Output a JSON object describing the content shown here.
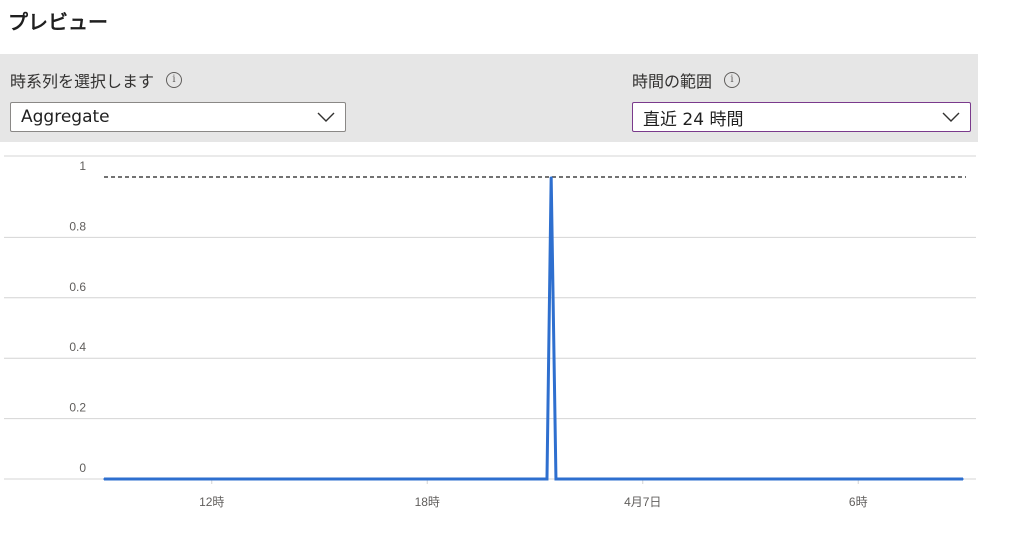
{
  "page": {
    "title": "プレビュー"
  },
  "filters": {
    "series": {
      "label": "時系列を選択します",
      "value": "Aggregate",
      "info_icon": "info-icon"
    },
    "time_range": {
      "label": "時間の範囲",
      "value": "直近 24 時間",
      "info_icon": "info-icon"
    }
  },
  "colors": {
    "line": "#2e6fcf",
    "threshold": "#1f1f1f",
    "grid": "#d4d4d4",
    "filter_bg": "#e6e6e6",
    "active_border": "#7a3a8c"
  },
  "chart_data": {
    "type": "line",
    "title": "",
    "xlabel": "",
    "ylabel": "",
    "x_ticks": [
      "12時",
      "18時",
      "4月7日",
      "6時"
    ],
    "y_ticks": [
      "0",
      "0.2",
      "0.4",
      "0.6",
      "0.8",
      "1"
    ],
    "ylim": [
      0,
      1
    ],
    "grid": true,
    "threshold": {
      "value": 1,
      "style": "dashed"
    },
    "series": [
      {
        "x": [
          "09:00",
          "21:20",
          "21:27",
          "21:35",
          "08:55"
        ],
        "values": [
          0,
          0,
          1,
          0,
          0
        ]
      }
    ]
  }
}
